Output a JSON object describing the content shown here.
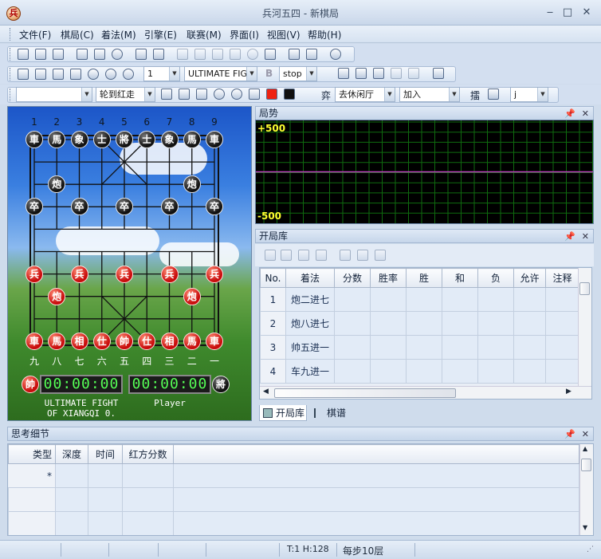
{
  "window": {
    "title": "兵河五四 - 新棋局",
    "icon_char": "兵",
    "min": "‒",
    "max": "□",
    "close": "✕"
  },
  "menu": [
    "文件(F)",
    "棋局(C)",
    "着法(M)",
    "引擎(E)",
    "联赛(M)",
    "界面(I)",
    "视图(V)",
    "帮助(H)"
  ],
  "toolbar3": {
    "number": "1",
    "engine": "ULTIMATE FIG",
    "bold": "B",
    "stop": "stop"
  },
  "toolbar4": {
    "empty_combo": "",
    "turn": "轮到红走",
    "yi": "弈",
    "hall": "去休闲厅",
    "join": "加入",
    "pick": "擂",
    "level": "j"
  },
  "board": {
    "top_files": [
      "1",
      "2",
      "3",
      "4",
      "5",
      "6",
      "7",
      "8",
      "9"
    ],
    "bottom_files": [
      "九",
      "八",
      "七",
      "六",
      "五",
      "四",
      "三",
      "二",
      "一"
    ],
    "black_pieces": [
      {
        "c": "車",
        "f": 0,
        "r": 0
      },
      {
        "c": "馬",
        "f": 1,
        "r": 0
      },
      {
        "c": "象",
        "f": 2,
        "r": 0
      },
      {
        "c": "士",
        "f": 3,
        "r": 0
      },
      {
        "c": "將",
        "f": 4,
        "r": 0
      },
      {
        "c": "士",
        "f": 5,
        "r": 0
      },
      {
        "c": "象",
        "f": 6,
        "r": 0
      },
      {
        "c": "馬",
        "f": 7,
        "r": 0
      },
      {
        "c": "車",
        "f": 8,
        "r": 0
      },
      {
        "c": "炮",
        "f": 1,
        "r": 2
      },
      {
        "c": "炮",
        "f": 7,
        "r": 2
      },
      {
        "c": "卒",
        "f": 0,
        "r": 3
      },
      {
        "c": "卒",
        "f": 2,
        "r": 3
      },
      {
        "c": "卒",
        "f": 4,
        "r": 3
      },
      {
        "c": "卒",
        "f": 6,
        "r": 3
      },
      {
        "c": "卒",
        "f": 8,
        "r": 3
      }
    ],
    "red_pieces": [
      {
        "c": "兵",
        "f": 0,
        "r": 6
      },
      {
        "c": "兵",
        "f": 2,
        "r": 6
      },
      {
        "c": "兵",
        "f": 4,
        "r": 6
      },
      {
        "c": "兵",
        "f": 6,
        "r": 6
      },
      {
        "c": "兵",
        "f": 8,
        "r": 6
      },
      {
        "c": "炮",
        "f": 1,
        "r": 7
      },
      {
        "c": "炮",
        "f": 7,
        "r": 7
      },
      {
        "c": "車",
        "f": 0,
        "r": 9
      },
      {
        "c": "馬",
        "f": 1,
        "r": 9
      },
      {
        "c": "相",
        "f": 2,
        "r": 9
      },
      {
        "c": "仕",
        "f": 3,
        "r": 9
      },
      {
        "c": "帥",
        "f": 4,
        "r": 9
      },
      {
        "c": "仕",
        "f": 5,
        "r": 9
      },
      {
        "c": "相",
        "f": 6,
        "r": 9
      },
      {
        "c": "馬",
        "f": 7,
        "r": 9
      },
      {
        "c": "車",
        "f": 8,
        "r": 9
      }
    ],
    "red_badge": "帥",
    "black_badge": "將",
    "red_clock": "00:00:00",
    "black_clock": "00:00:00",
    "red_player": "ULTIMATE FIGHT\nOF XIANGQI 0.",
    "black_player": "Player"
  },
  "trend": {
    "title": "局势",
    "top": "+500",
    "bottom": "-500"
  },
  "opening": {
    "title": "开局库",
    "columns": [
      "No.",
      "着法",
      "分数",
      "胜率",
      "胜",
      "和",
      "负",
      "允许",
      "注释"
    ],
    "rows": [
      [
        "1",
        "炮二进七"
      ],
      [
        "2",
        "炮八进七"
      ],
      [
        "3",
        "帅五进一"
      ],
      [
        "4",
        "车九进一"
      ]
    ],
    "tabs": [
      "开局库",
      "棋谱"
    ]
  },
  "thinking": {
    "title": "思考细节",
    "columns": [
      "类型",
      "深度",
      "时间",
      "红方分数"
    ],
    "new_row": "*"
  },
  "status": {
    "t": "T:1 H:128",
    "depth": "每步10层"
  },
  "colors": {
    "accent": "#d3dff0",
    "red_piece": "#c80c0c",
    "black_piece": "#111111",
    "graph_grid": "#0f6b0f",
    "graph_line": "#c040c0"
  }
}
